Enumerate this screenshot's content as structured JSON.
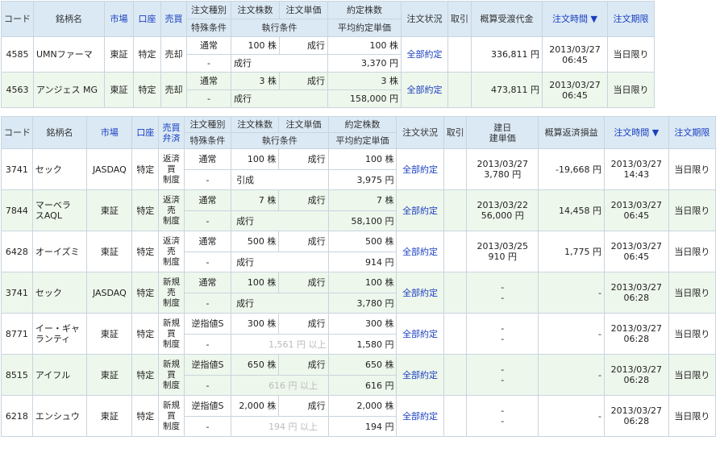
{
  "spot": {
    "headers": {
      "code": "コード",
      "name": "銘柄名",
      "market": "市場",
      "account": "口座",
      "side": "売買",
      "type": "注文種別",
      "qty": "注文株数",
      "price": "注文単価",
      "filled_qty": "約定株数",
      "status": "注文状況",
      "cancel": "取引",
      "amount": "概算受渡代金",
      "time": "注文時間 ▼",
      "expiry": "注文期限",
      "special": "特殊条件",
      "exec": "執行条件",
      "avg": "平均約定単価"
    },
    "rows": [
      {
        "code": "4585",
        "name": "UMNファーマ",
        "market": "東証",
        "account": "特定",
        "side": "売却",
        "type": "通常",
        "qty": "100 株",
        "price": "成行",
        "filled": "100 株",
        "special": "-",
        "exec": "成行",
        "avg": "3,370 円",
        "status": "全部約定",
        "amount": "336,811 円",
        "date": "2013/03/27",
        "time": "06:45",
        "expiry": "当日限り"
      },
      {
        "code": "4563",
        "name": "アンジェス MG",
        "market": "東証",
        "account": "特定",
        "side": "売却",
        "type": "通常",
        "qty": "3 株",
        "price": "成行",
        "filled": "3 株",
        "special": "-",
        "exec": "成行",
        "avg": "158,000 円",
        "status": "全部約定",
        "amount": "473,811 円",
        "date": "2013/03/27",
        "time": "06:45",
        "expiry": "当日限り"
      }
    ]
  },
  "margin": {
    "headers": {
      "code": "コード",
      "name": "銘柄名",
      "market": "市場",
      "account": "口座",
      "side1": "売買",
      "side2": "弁済",
      "type": "注文種別",
      "qty": "注文株数",
      "price": "注文単価",
      "filled_qty": "約定株数",
      "status": "注文状況",
      "cancel": "取引",
      "open1": "建日",
      "open2": "建単価",
      "pnl": "概算返済損益",
      "time": "注文時間 ▼",
      "expiry": "注文期限",
      "special": "特殊条件",
      "exec": "執行条件",
      "avg": "平均約定単価"
    },
    "rows": [
      {
        "code": "3741",
        "name": [
          "セック"
        ],
        "market": "JASDAQ",
        "account": "特定",
        "side": [
          "返済",
          "買",
          "制度"
        ],
        "type": "通常",
        "qty": "100 株",
        "price": "成行",
        "filled": "100 株",
        "special": "-",
        "exec": "引成",
        "exec_gray": false,
        "avg": "3,975 円",
        "status": "全部約定",
        "open_date": "2013/03/27",
        "open_price": "3,780 円",
        "pnl": "-19,668 円",
        "date": "2013/03/27",
        "time": "14:43",
        "expiry": "当日限り"
      },
      {
        "code": "7844",
        "name": [
          "マーベラ",
          "スAQL"
        ],
        "market": "東証",
        "account": "特定",
        "side": [
          "返済",
          "売",
          "制度"
        ],
        "type": "通常",
        "qty": "7 株",
        "price": "成行",
        "filled": "7 株",
        "special": "-",
        "exec": "成行",
        "exec_gray": false,
        "avg": "58,100 円",
        "status": "全部約定",
        "open_date": "2013/03/22",
        "open_price": "56,000 円",
        "pnl": "14,458 円",
        "date": "2013/03/27",
        "time": "06:45",
        "expiry": "当日限り"
      },
      {
        "code": "6428",
        "name": [
          "オーイズミ"
        ],
        "market": "東証",
        "account": "特定",
        "side": [
          "返済",
          "売",
          "制度"
        ],
        "type": "通常",
        "qty": "500 株",
        "price": "成行",
        "filled": "500 株",
        "special": "-",
        "exec": "成行",
        "exec_gray": false,
        "avg": "914 円",
        "status": "全部約定",
        "open_date": "2013/03/25",
        "open_price": "910 円",
        "pnl": "1,775 円",
        "date": "2013/03/27",
        "time": "06:45",
        "expiry": "当日限り"
      },
      {
        "code": "3741",
        "name": [
          "セック"
        ],
        "market": "JASDAQ",
        "account": "特定",
        "side": [
          "新規",
          "売",
          "制度"
        ],
        "type": "通常",
        "qty": "100 株",
        "price": "成行",
        "filled": "100 株",
        "special": "-",
        "exec": "成行",
        "exec_gray": false,
        "avg": "3,780 円",
        "status": "全部約定",
        "open_date": "-",
        "open_price": "-",
        "pnl": "-",
        "date": "2013/03/27",
        "time": "06:28",
        "expiry": "当日限り"
      },
      {
        "code": "8771",
        "name": [
          "イー・ギャ",
          "ランティ"
        ],
        "market": "東証",
        "account": "特定",
        "side": [
          "新規",
          "買",
          "制度"
        ],
        "type": "逆指値S",
        "qty": "300 株",
        "price": "成行",
        "filled": "300 株",
        "special": "-",
        "exec": "1,561 円 以上",
        "exec_gray": true,
        "avg": "1,580 円",
        "status": "全部約定",
        "open_date": "-",
        "open_price": "-",
        "pnl": "-",
        "date": "2013/03/27",
        "time": "06:28",
        "expiry": "当日限り"
      },
      {
        "code": "8515",
        "name": [
          "アイフル"
        ],
        "market": "東証",
        "account": "特定",
        "side": [
          "新規",
          "買",
          "制度"
        ],
        "type": "逆指値S",
        "qty": "650 株",
        "price": "成行",
        "filled": "650 株",
        "special": "-",
        "exec": "616 円 以上",
        "exec_gray": true,
        "avg": "616 円",
        "status": "全部約定",
        "open_date": "-",
        "open_price": "-",
        "pnl": "-",
        "date": "2013/03/27",
        "time": "06:28",
        "expiry": "当日限り"
      },
      {
        "code": "6218",
        "name": [
          "エンシュウ"
        ],
        "market": "東証",
        "account": "特定",
        "side": [
          "新規",
          "買",
          "制度"
        ],
        "type": "逆指値S",
        "qty": "2,000 株",
        "price": "成行",
        "filled": "2,000 株",
        "special": "-",
        "exec": "194 円 以上",
        "exec_gray": true,
        "avg": "194 円",
        "status": "全部約定",
        "open_date": "-",
        "open_price": "-",
        "pnl": "-",
        "date": "2013/03/27",
        "time": "06:28",
        "expiry": "当日限り"
      }
    ]
  }
}
